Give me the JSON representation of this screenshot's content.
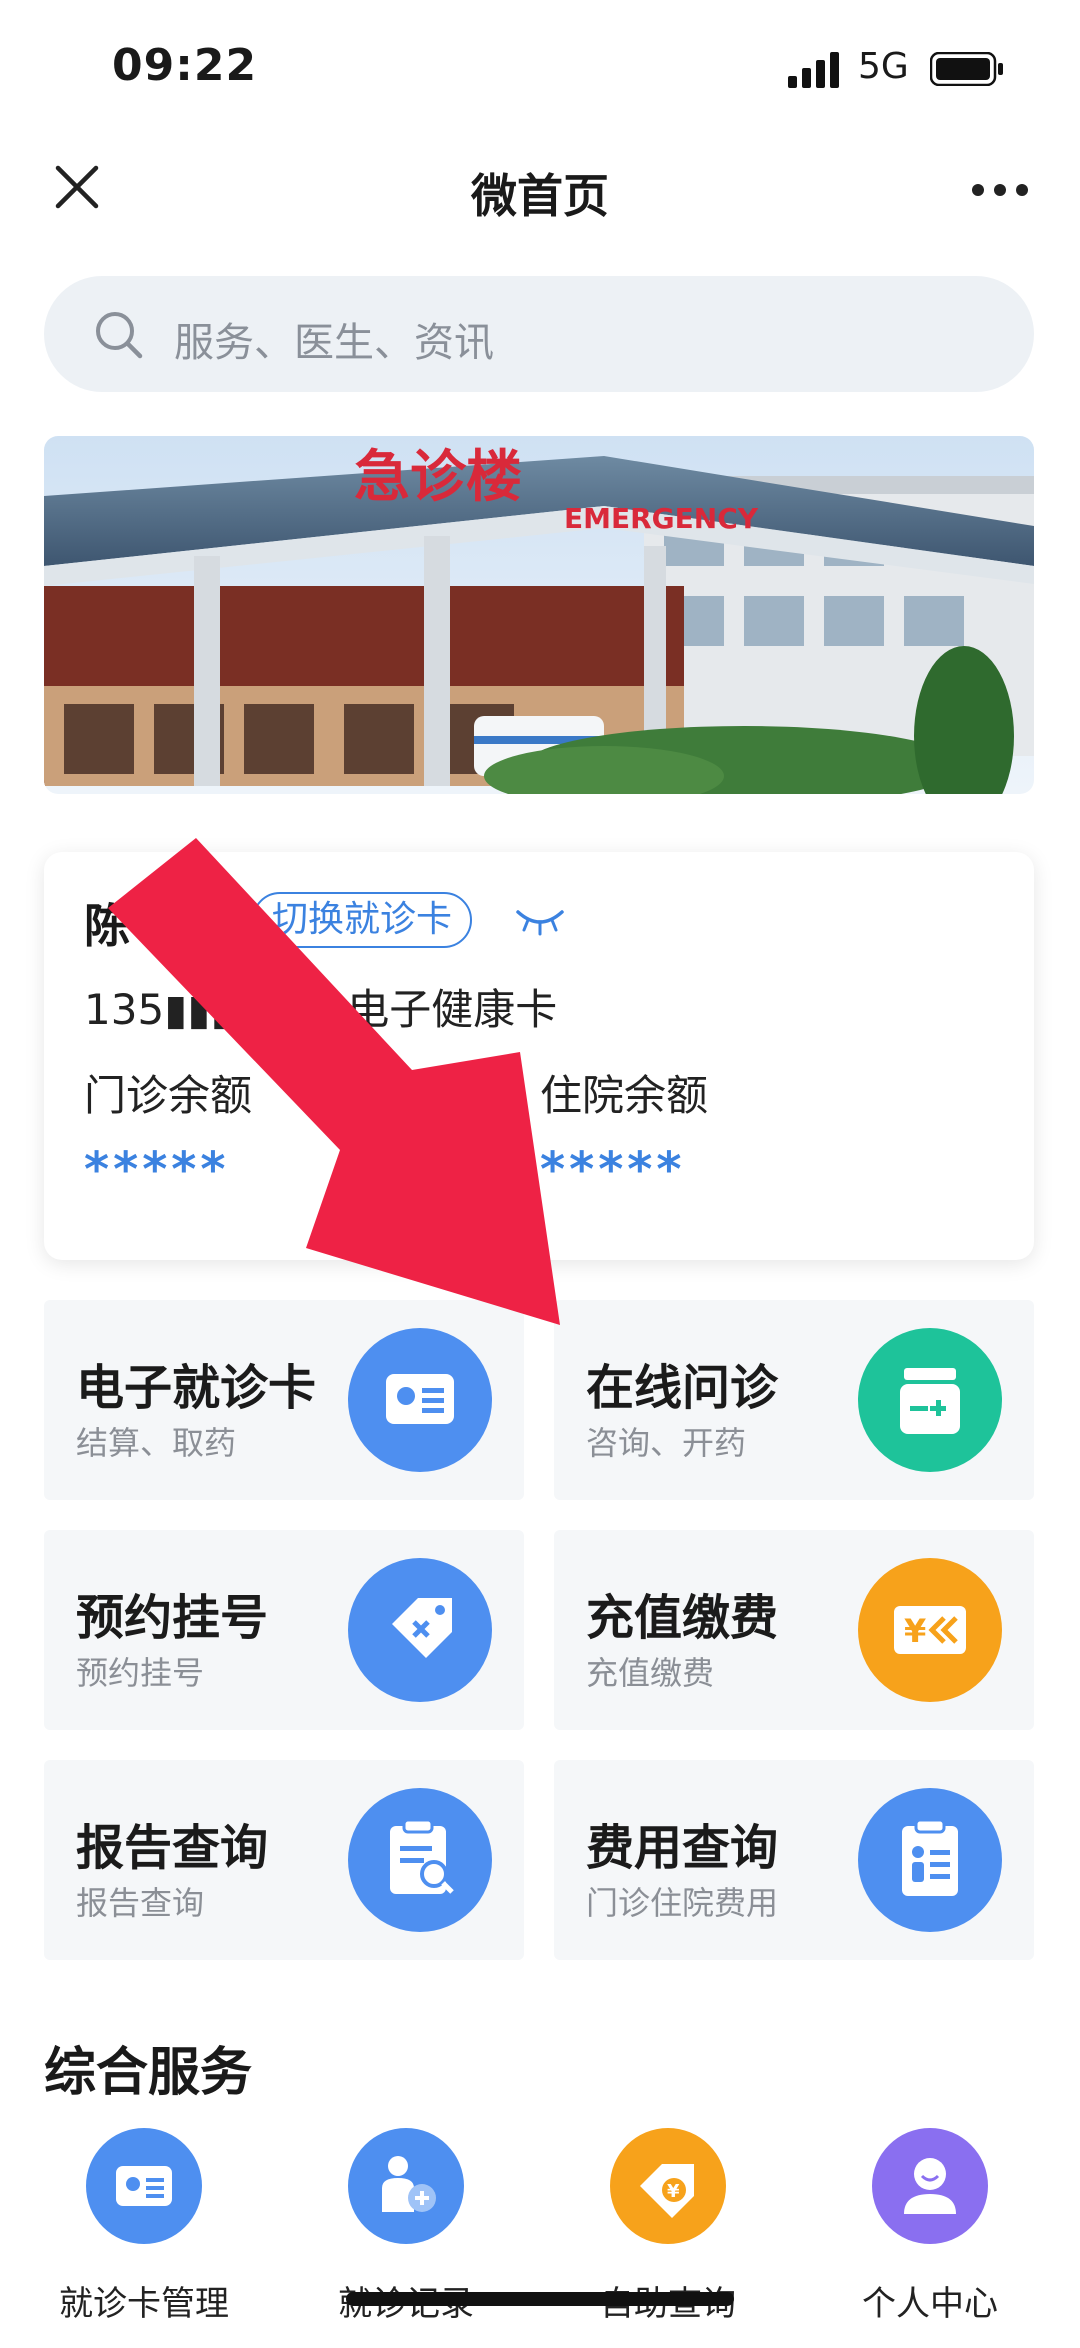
{
  "status_bar": {
    "time": "09:22",
    "network": "5G"
  },
  "nav": {
    "title": "微首页"
  },
  "search": {
    "placeholder": "服务、医生、资讯"
  },
  "banner": {
    "sign_text": "急诊楼",
    "sign_en": "EMERGENCY"
  },
  "card": {
    "name": "陈",
    "switch_label": "切换就诊卡",
    "line": "135▮▮▮▮▮0 | 电子健康卡",
    "outpatient_label": "门诊余额",
    "inpatient_label": "住院余额",
    "outpatient_value": "*****",
    "inpatient_value": "*****"
  },
  "tiles": [
    {
      "title": "电子就诊卡",
      "sub": "结算、取药",
      "icon": "id-card-icon",
      "color": "#4e8ff0"
    },
    {
      "title": "在线问诊",
      "sub": "咨询、开药",
      "icon": "medicine-bottle-icon",
      "color": "#1ec39a"
    },
    {
      "title": "预约挂号",
      "sub": "预约挂号",
      "icon": "tag-icon",
      "color": "#4e8ff0"
    },
    {
      "title": "充值缴费",
      "sub": "充值缴费",
      "icon": "yuan-card-icon",
      "color": "#f7a21b"
    },
    {
      "title": "报告查询",
      "sub": "报告查询",
      "icon": "report-search-icon",
      "color": "#4e8ff0"
    },
    {
      "title": "费用查询",
      "sub": "门诊住院费用",
      "icon": "clipboard-icon",
      "color": "#4e8ff0"
    }
  ],
  "section": {
    "title": "综合服务"
  },
  "quick_services": [
    {
      "label": "就诊卡管理",
      "icon": "id-card-icon",
      "color": "#4e8ff0"
    },
    {
      "label": "就诊记录",
      "icon": "user-record-icon",
      "color": "#4e8ff0"
    },
    {
      "label": "自助查询",
      "icon": "yuan-tag-icon",
      "color": "#f7a21b"
    },
    {
      "label": "个人中心",
      "icon": "user-icon",
      "color": "#8a6ff0"
    }
  ],
  "annotation": {
    "arrow_color": "#ee2245"
  }
}
